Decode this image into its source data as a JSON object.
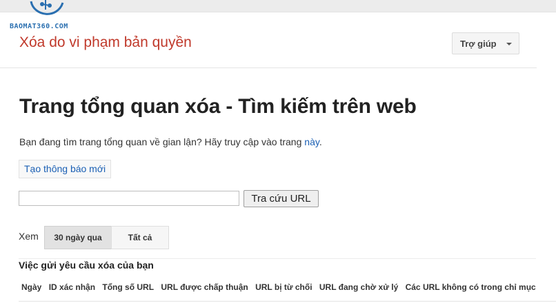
{
  "watermark": {
    "text": "BAOMAT360.COM",
    "accent": "#2a6fb0"
  },
  "header": {
    "title": "Xóa do vi phạm bản quyền",
    "title_color": "#c0392b",
    "help_label": "Trợ giúp"
  },
  "main": {
    "heading": "Trang tổng quan xóa - Tìm kiếm trên web",
    "notice_text": "Bạn đang tìm trang tổng quan về gian lận? Hãy truy cập vào trang ",
    "notice_link": "này",
    "notice_end": ".",
    "new_notice_label": "Tạo thông báo mới",
    "url_input_value": "",
    "url_input_placeholder": "",
    "lookup_label": "Tra cứu URL",
    "link_color": "#1a5fb4"
  },
  "filter": {
    "view_label": "Xem",
    "options": [
      "30 ngày qua",
      "Tất cả"
    ],
    "selected": "30 ngày qua"
  },
  "requests": {
    "section_title": "Việc gửi yêu cầu xóa của bạn",
    "columns": [
      "Ngày",
      "ID xác nhận",
      "Tổng số URL",
      "URL được chấp thuận",
      "URL bị từ chối",
      "URL đang chờ xử lý",
      "Các URL không có trong chỉ mục"
    ]
  }
}
